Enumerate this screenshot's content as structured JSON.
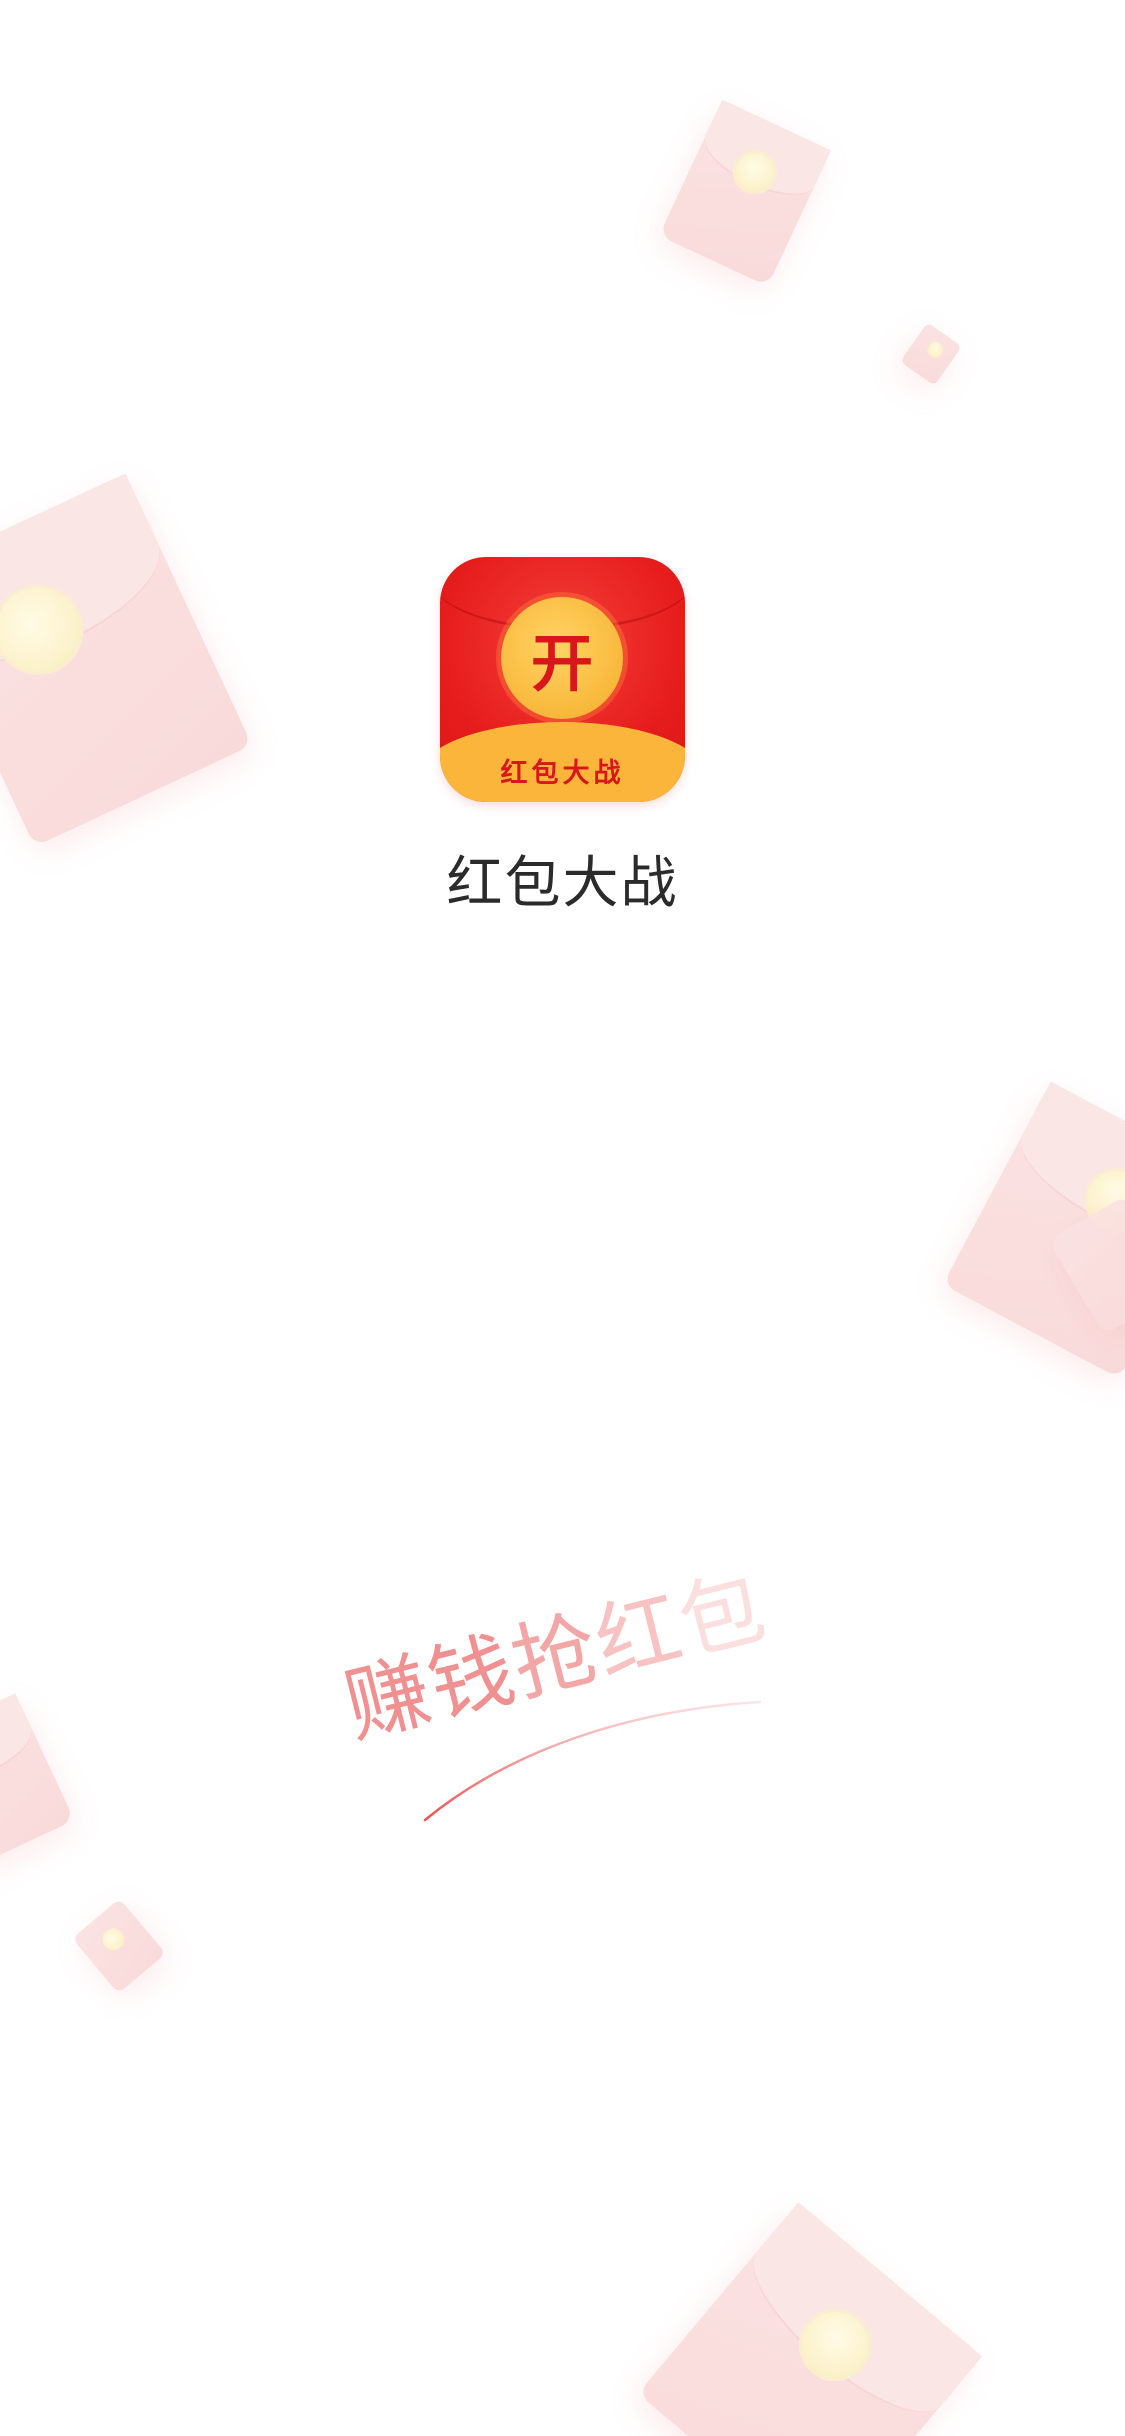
{
  "app": {
    "name": "红包大战",
    "icon": {
      "coin_glyph": "开",
      "band_text": "红包大战"
    }
  },
  "slogan": {
    "part1": "赚钱",
    "part2": "抢",
    "part3": "红",
    "part4": "包"
  },
  "colors": {
    "background": "#ffffff",
    "icon_red": "#e61d1d",
    "icon_gold": "#f8b83b",
    "slogan_red": "#ee7d7d",
    "text_dark": "#2b2b2b"
  },
  "decorations": {
    "icon_names": [
      "red-envelope-icon"
    ]
  }
}
